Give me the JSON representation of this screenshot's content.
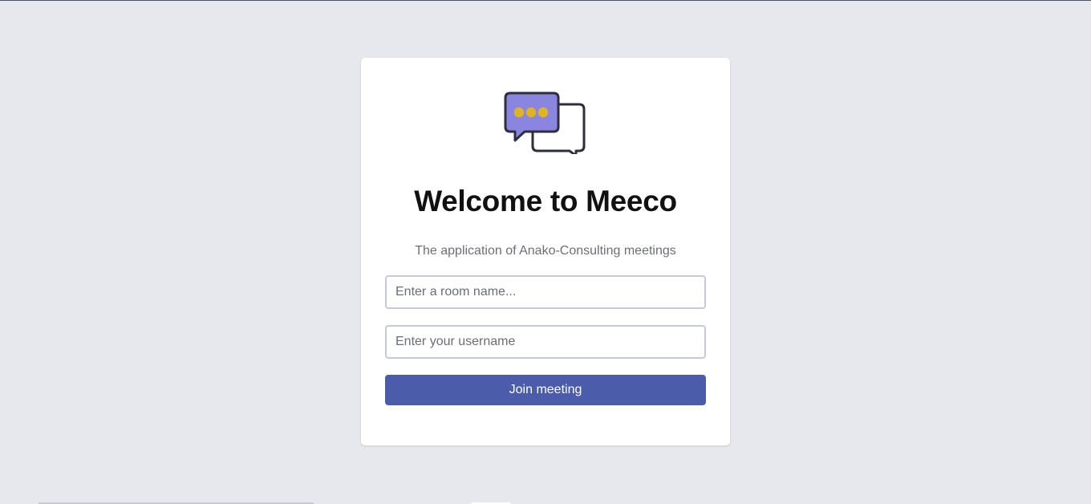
{
  "app": {
    "title": "Welcome to Meeco",
    "subtitle": "The application of Anako-Consulting meetings"
  },
  "logo": {
    "icon": "chat-bubbles-icon",
    "colors": {
      "front_bubble": "#8a86e0",
      "dots": "#e0b323",
      "outline": "#2e2e40"
    }
  },
  "form": {
    "room_name_placeholder": "Enter a room name...",
    "room_name_value": "",
    "username_placeholder": "Enter your username",
    "username_value": "",
    "join_label": "Join meeting"
  },
  "colors": {
    "background": "#e7e8ee",
    "card": "#ffffff",
    "accent": "#4b5cab",
    "input_border": "#c6c8dc"
  }
}
